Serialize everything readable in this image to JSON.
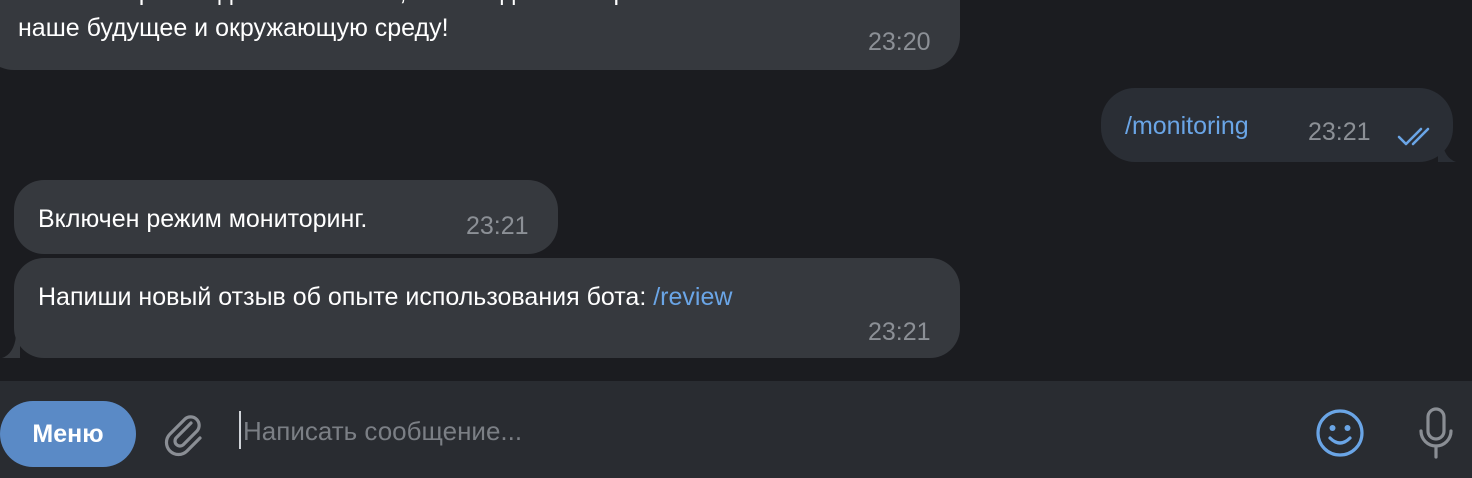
{
  "messages": [
    {
      "id": "m1",
      "direction": "incoming",
      "cut_line": "нюансов производства. Помните, что каждый выбор влияет на",
      "text": "наше будущее и окружающую среду!",
      "time": "23:20"
    },
    {
      "id": "m2",
      "direction": "outgoing",
      "command": "/monitoring",
      "time": "23:21",
      "status_icon": "double-check-icon"
    },
    {
      "id": "m3",
      "direction": "incoming",
      "text": "Включен режим мониторинг.",
      "time": "23:21"
    },
    {
      "id": "m4",
      "direction": "incoming",
      "text": "Напиши новый отзыв об опыте использования бота: ",
      "command": "/review",
      "time": "23:21"
    }
  ],
  "composer": {
    "menu_label": "Меню",
    "placeholder": "Написать сообщение...",
    "value": "",
    "icons": [
      "paperclip-icon",
      "smile-icon",
      "microphone-icon"
    ]
  },
  "colors": {
    "background": "#1b1c20",
    "bubble": "#36393e",
    "accent": "#6aa5e6",
    "menu_button": "#5a8ac6",
    "time": "#8c9096"
  }
}
